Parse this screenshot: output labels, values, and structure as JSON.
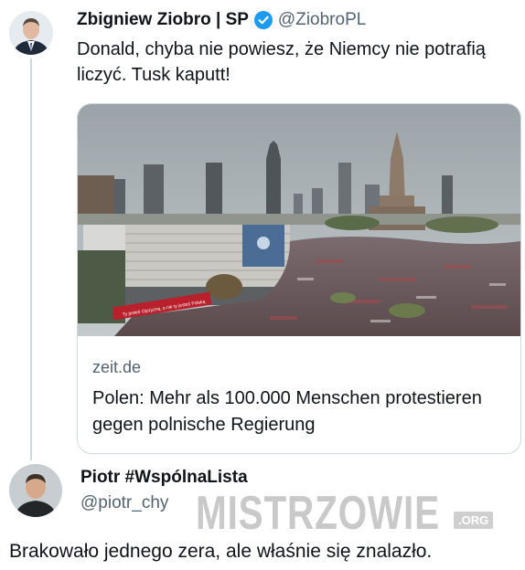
{
  "post": {
    "author_name": "Zbigniew Ziobro | SP",
    "handle": "@ZiobroPL",
    "text": "Donald, chyba nie powiesz, że Niemcy nie potrafią liczyć. Tusk kaputt!",
    "card": {
      "domain": "zeit.de",
      "title": "Polen: Mehr als 100.000 Menschen protestieren gegen polnische Regierung",
      "banner_text": "Ty jesteś Ojczyzną, a nie ty jesteś Polską"
    }
  },
  "reply": {
    "author_name": "Piotr #WspólnaLista",
    "handle": "@piotr_chy",
    "text": "Brakowało jednego zera, ale właśnie się znalazło."
  },
  "watermark": {
    "text": "MISTRZOWIE",
    "suffix": ".ORG"
  },
  "colors": {
    "verified_badge": "#1d9bf0",
    "secondary_text": "#536471",
    "border": "#cfd9de"
  },
  "icons": {
    "verified": "verified-badge-icon"
  }
}
